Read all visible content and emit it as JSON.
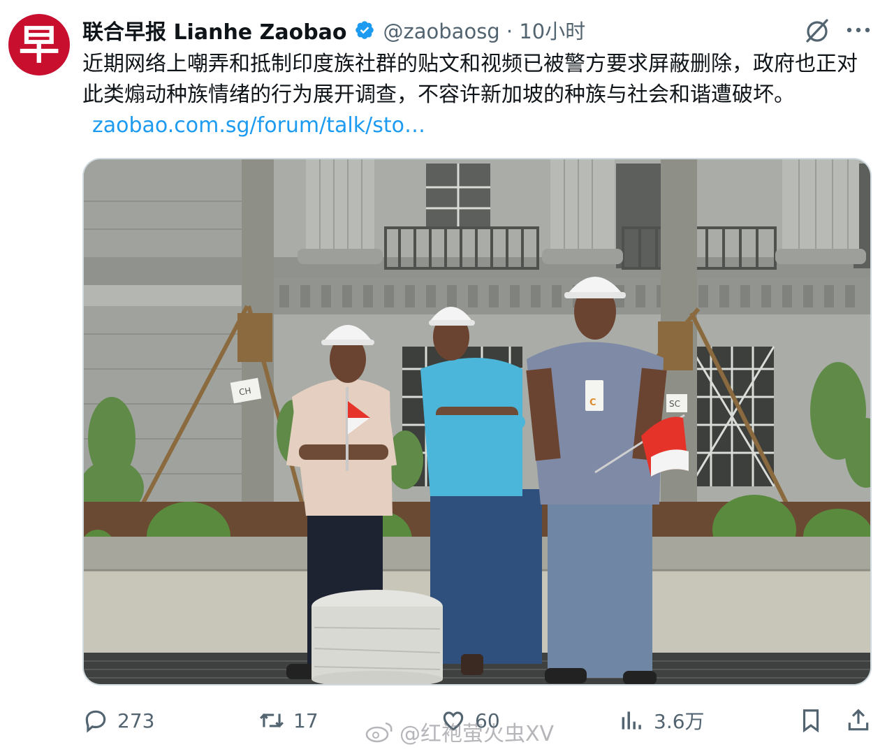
{
  "author": {
    "avatar_glyph": "早",
    "display_name": "联合早报 Lianhe Zaobao",
    "handle_time": "@zaobaosg · 10小时",
    "verified": true,
    "brand_color": "#c8102e"
  },
  "tweet": {
    "text": "近期网络上嘲弄和抵制印度族社群的贴文和视频已被警方要求屏蔽删除，政府也正对此类煽动种族情绪的行为展开调查，不容许新加坡的种族与社会和谐遭破坏。",
    "link": "zaobao.com.sg/forum/talk/sto…",
    "link_color": "#1d9bf0"
  },
  "media": {
    "badge_left": "CH",
    "badge_right": "SC",
    "badge_id": "C"
  },
  "actions": {
    "replies": "273",
    "retweets": "17",
    "likes": "60",
    "views": "3.6万",
    "icons": [
      "reply-icon",
      "retweet-icon",
      "like-icon",
      "views-icon",
      "bookmark-icon",
      "share-icon"
    ]
  },
  "watermark": {
    "text": "@红袍萤火虫XV"
  }
}
